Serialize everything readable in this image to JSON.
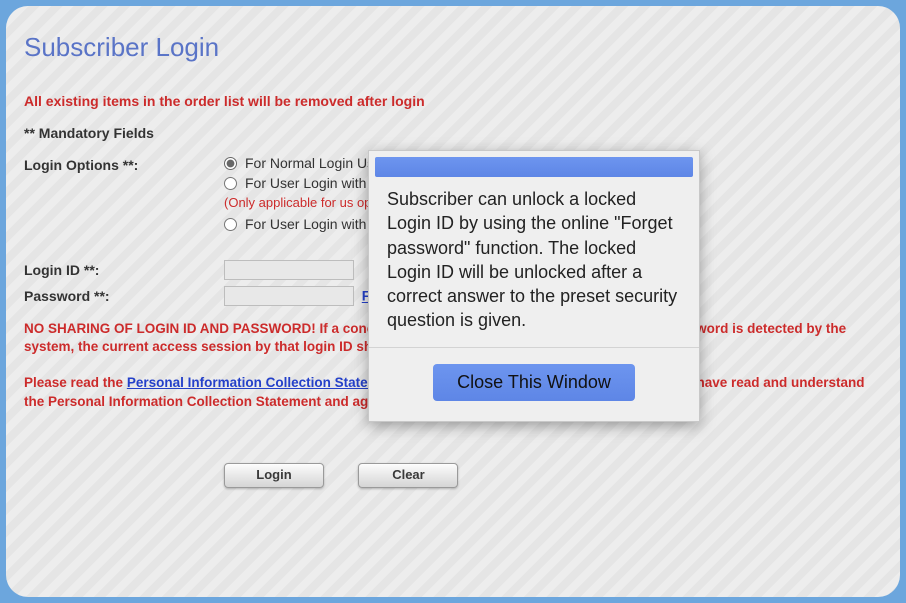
{
  "title": "Subscriber Login",
  "notice_remove": "All existing items in the order list will be removed after login",
  "mandatory_label": "** Mandatory Fields",
  "login_options": {
    "label": "Login Options **:",
    "opt1": "For Normal Login Us",
    "opt2": "For User Login with",
    "opt2_note": "(Only applicable for us option)",
    "opt3": "For User Login with"
  },
  "login_id": {
    "label": "Login ID **:",
    "value": ""
  },
  "password": {
    "label": "Password **:",
    "value": "",
    "forgot_prefix": "For"
  },
  "warning": "NO SHARING OF LOGIN ID AND PASSWORD! If a concurrent access of the same set of login ID and password is detected by the system, the current access session by that login ID shown on the screen may be stopped immediately.",
  "pica": {
    "prefix": "Please read the",
    "link": " Personal Information Collection Statement ",
    "suffix": ". By clicking \"Login\", you confirm that you have read and understand the Personal Information Collection Statement and agree to it."
  },
  "buttons": {
    "login": "Login",
    "clear": "Clear"
  },
  "modal": {
    "body": "Subscriber can unlock a locked Login ID by using the online \"Forget password\" function. The locked Login ID will be unlocked after a correct answer to the preset security question is given.",
    "close": "Close This Window"
  }
}
